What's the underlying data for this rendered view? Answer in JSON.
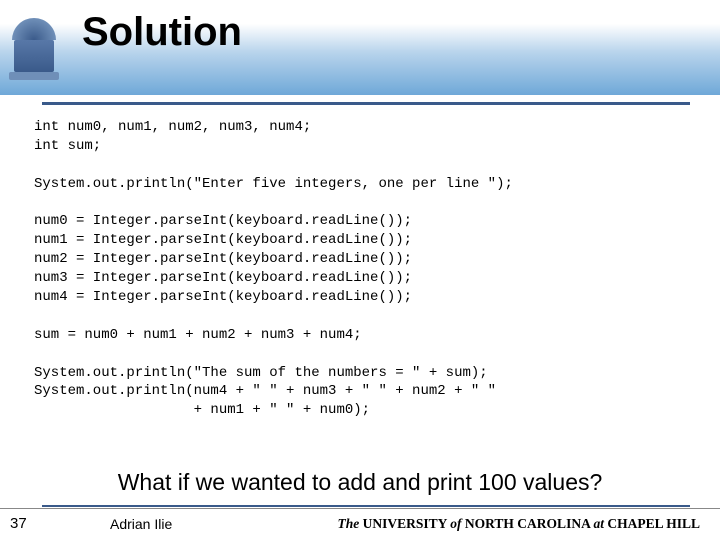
{
  "title": "Solution",
  "code": "int num0, num1, num2, num3, num4;\nint sum;\n\nSystem.out.println(\"Enter five integers, one per line \");\n\nnum0 = Integer.parseInt(keyboard.readLine());\nnum1 = Integer.parseInt(keyboard.readLine());\nnum2 = Integer.parseInt(keyboard.readLine());\nnum3 = Integer.parseInt(keyboard.readLine());\nnum4 = Integer.parseInt(keyboard.readLine());\n\nsum = num0 + num1 + num2 + num3 + num4;\n\nSystem.out.println(\"The sum of the numbers = \" + sum);\nSystem.out.println(num4 + \" \" + num3 + \" \" + num2 + \" \"\n                   + num1 + \" \" + num0);",
  "question": "What if we wanted to add and print 100 values?",
  "page_number": "37",
  "author": "Adrian Ilie",
  "university": {
    "the": "The",
    "u": " UNIVERSITY ",
    "of": "of",
    "nc": " NORTH CAROLINA ",
    "at": "at",
    "ch": " CHAPEL HILL"
  }
}
